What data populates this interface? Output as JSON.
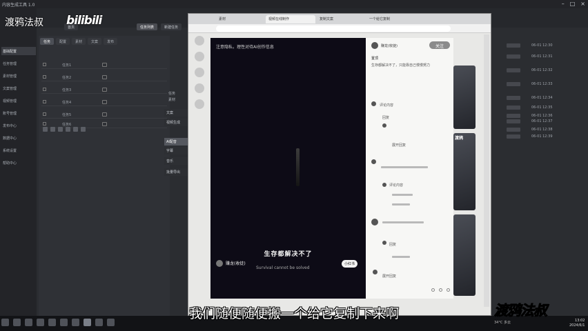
{
  "app": {
    "title": "内容生成工具 1.0",
    "sidebar": [
      "基础配置",
      "任务管理",
      "素材管理",
      "文案管理",
      "视频管理",
      "账号管理",
      "发布中心",
      "数据中心",
      "系统设置",
      "帮助中心"
    ],
    "tabs": [
      "首页",
      "任务列表",
      "新建任务"
    ],
    "panel_tabs": [
      "任务",
      "配置",
      "素材",
      "文案",
      "发布"
    ],
    "rows": [
      "任务1",
      "任务2",
      "任务3",
      "任务4",
      "任务5",
      "任务6"
    ],
    "mid_menu": [
      "文案",
      "视频生成",
      "AI配音",
      "字幕",
      "音乐",
      "批量导出"
    ],
    "mid_labels": [
      "任务",
      "素材"
    ],
    "right_rows": [
      "06-01 12:30",
      "06-01 12:31",
      "06-01 12:32",
      "06-01 12:33",
      "06-01 12:34",
      "06-01 12:35",
      "06-01 12:36",
      "06-01 12:37",
      "06-01 12:38",
      "06-01 12:39"
    ]
  },
  "browser": {
    "tabs": [
      "素材",
      "视频在线制作",
      "复制文案",
      "一个给它复制"
    ],
    "video": {
      "note": "注意隐私，理性对待AI创作信息",
      "caption": "生存都解决不了",
      "author": "赚龙(收徒)",
      "subtitle_en": "Survival cannot be solved",
      "button": "小红书"
    },
    "comments": {
      "author": "赚龙(收徒)",
      "follow": "关注",
      "title": "置顶",
      "desc": "生存都解决不了，只能靠自己慢慢努力",
      "items": [
        "评论内容",
        "回复",
        "展开回复",
        "评论内容",
        "回复",
        "展开回复"
      ]
    },
    "thumb_label": "渡鸦"
  },
  "taskbar": {
    "tray": "34°C 多云",
    "time": "13:02",
    "date": "2024/6/1"
  },
  "overlay": {
    "watermark_left": "渡鸦法叔",
    "watermark_bili": "bilibili",
    "watermark_right": "渡鸦法叔",
    "subtitle": "我们随便随便搬一个给它复制下来啊"
  }
}
